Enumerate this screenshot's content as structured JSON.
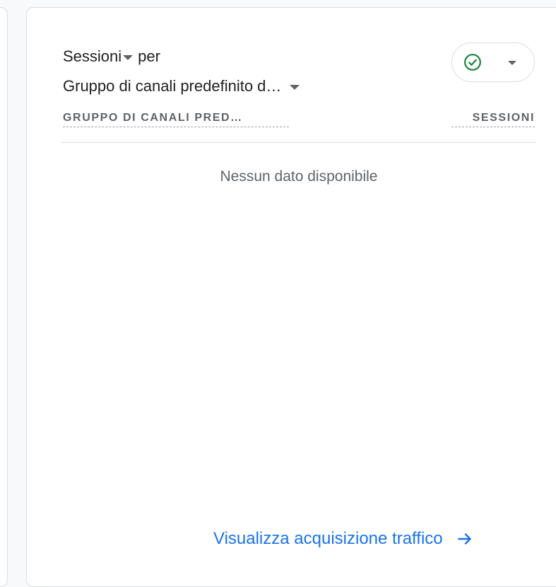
{
  "card": {
    "metric": "Sessioni",
    "connector": "per",
    "dimension": "Gruppo di canali predefinito d…",
    "status_icon": "check-circle-icon",
    "status_color": "#188038",
    "table": {
      "columns": [
        "GRUPPO DI CANALI PRED…",
        "SESSIONI"
      ]
    },
    "empty_message": "Nessun dato disponibile",
    "footer_link": "Visualizza acquisizione traffico",
    "link_color": "#1a73e8"
  }
}
